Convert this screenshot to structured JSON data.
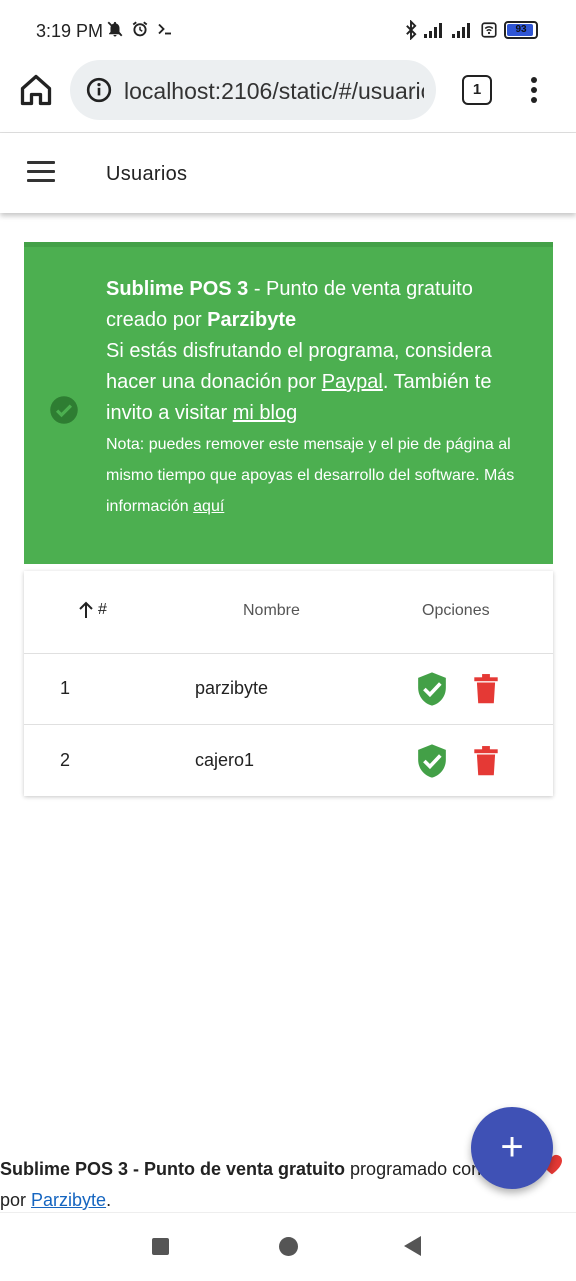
{
  "status_bar": {
    "time": "3:19 PM",
    "left_icons": [
      "bell-off-icon",
      "alarm-icon",
      "terminal-icon"
    ],
    "right_icons": [
      "bluetooth-icon",
      "signal-icon",
      "signal-icon",
      "wifi-icon"
    ],
    "battery": "93"
  },
  "browser": {
    "url": "localhost:2106/static/#/usuarios",
    "tab_count": "1"
  },
  "appbar": {
    "title": "Usuarios"
  },
  "notice": {
    "product": "Sublime POS 3",
    "line1_rest": " - Punto de venta gratuito creado por ",
    "author": "Parzibyte",
    "line2_a": "Si estás disfrutando el programa, considera hacer una donación por ",
    "paypal": "Paypal",
    "line2_b": ". También te invito a visitar ",
    "blog": "mi blog",
    "note": "Nota: puedes remover este mensaje y el pie de página al mismo tiempo que apoyas el desarrollo del software. Más información ",
    "here": "aquí",
    "color": "#4caf50"
  },
  "table": {
    "headers": {
      "num": "#",
      "name": "Nombre",
      "options": "Opciones"
    },
    "rows": [
      {
        "num": "1",
        "name": "parzibyte"
      },
      {
        "num": "2",
        "name": "cajero1"
      }
    ]
  },
  "footer": {
    "bold": "Sublime POS 3 - Punto de venta gratuito",
    "text": " programado con ",
    "by": "por ",
    "link": "Parzibyte",
    "end": "."
  },
  "fab": {
    "label": "+",
    "color": "#3f51b5"
  }
}
